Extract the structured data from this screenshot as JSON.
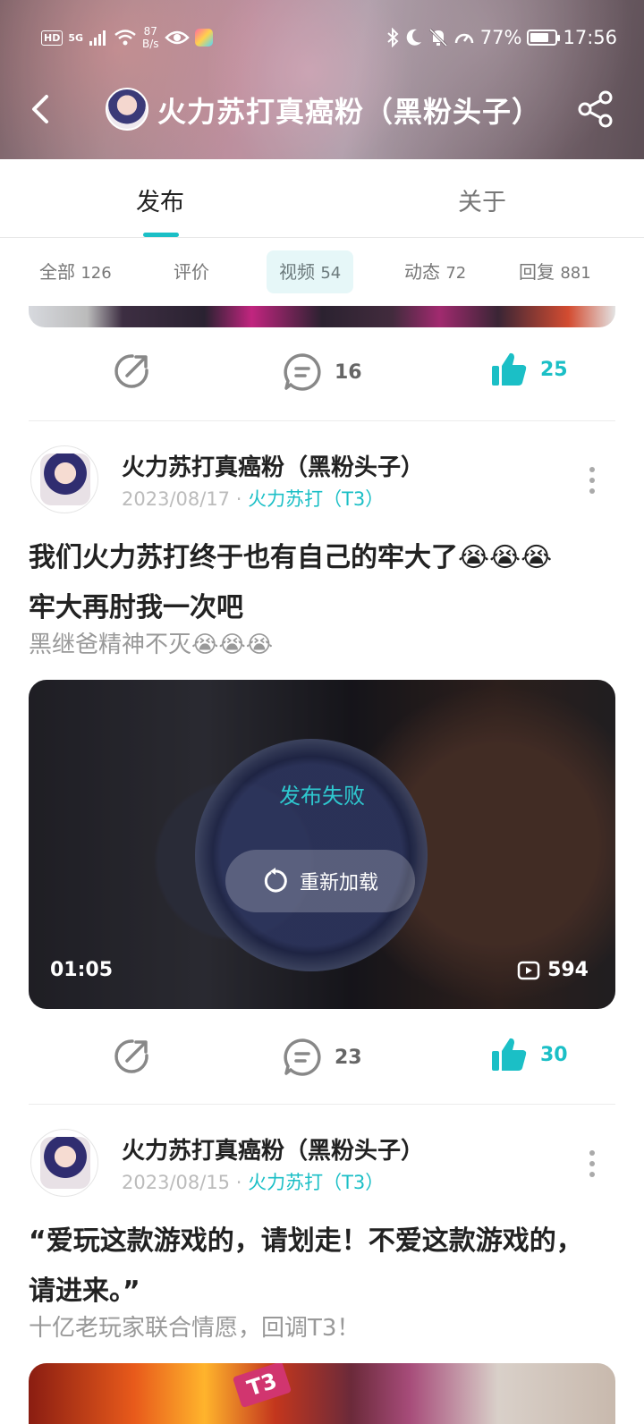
{
  "status_bar": {
    "hd": "HD",
    "net": "5G",
    "speed_value": "87",
    "speed_unit": "B/s",
    "battery": "77%",
    "battery_level": 0.77,
    "time": "17:56"
  },
  "header": {
    "title": "火力苏打真癌粉（黑粉头子）"
  },
  "tabs": [
    {
      "label": "发布",
      "active": true
    },
    {
      "label": "关于",
      "active": false
    }
  ],
  "filters": [
    {
      "label": "全部",
      "count": "126"
    },
    {
      "label": "评价",
      "count": ""
    },
    {
      "label": "视频",
      "count": "54",
      "active": true
    },
    {
      "label": "动态",
      "count": "72"
    },
    {
      "label": "回复",
      "count": "881"
    }
  ],
  "prev_post_actions": {
    "comments": "16",
    "likes": "25"
  },
  "posts": [
    {
      "author": "火力苏打真癌粉（黑粉头子）",
      "date": "2023/08/17",
      "separator": "·",
      "topic": "火力苏打（T3）",
      "title_line1": "我们火力苏打终于也有自己的牢大了😭😭😭",
      "title_line2": "牢大再肘我一次吧",
      "subtitle": "黑继爸精神不灭😭😭😭",
      "video": {
        "status": "发布失败",
        "reload_label": "重新加载",
        "duration": "01:05",
        "views": "594"
      },
      "comments": "23",
      "likes": "30"
    },
    {
      "author": "火力苏打真癌粉（黑粉头子）",
      "date": "2023/08/15",
      "separator": "·",
      "topic": "火力苏打（T3）",
      "title_line1": "“爱玩这款游戏的，请划走！不爱这款游戏的，",
      "title_line2": "请进来。”",
      "subtitle": "十亿老玩家联合情愿，回调T3！",
      "image_badge": "T3"
    }
  ],
  "colors": {
    "accent": "#1bbfc6",
    "muted": "#999999"
  }
}
